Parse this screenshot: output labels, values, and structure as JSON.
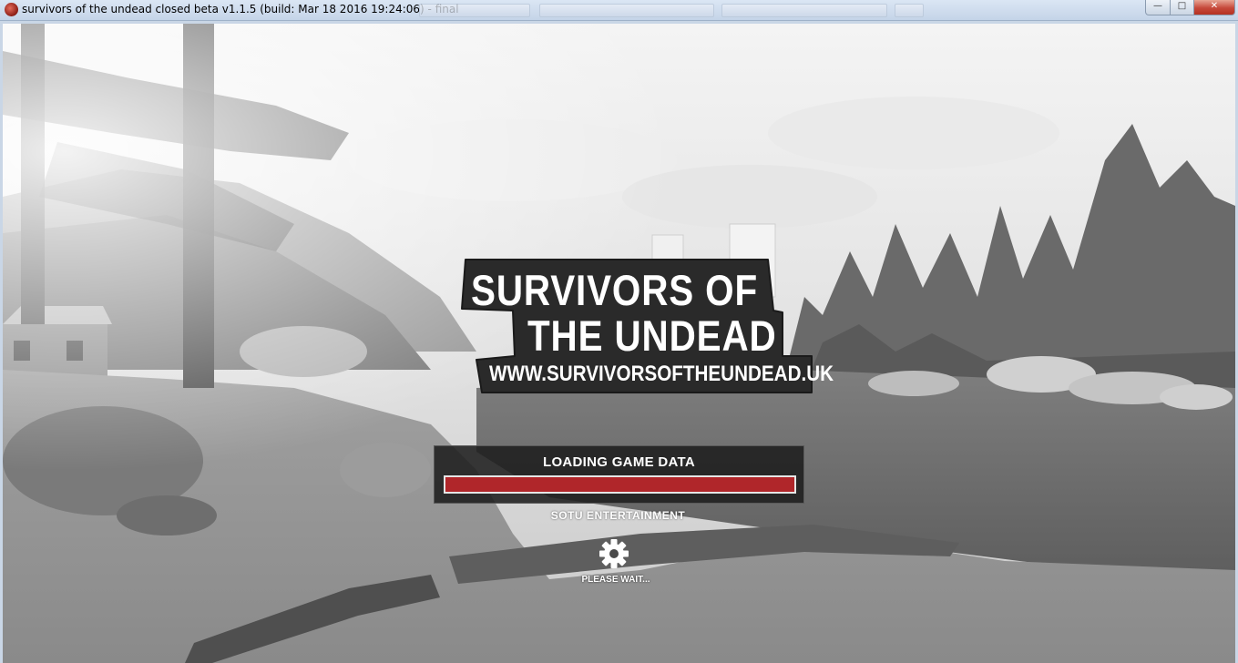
{
  "window": {
    "title": "survivors of the undead closed beta v1.1.5  (build: Mar 18 2016 19:24:06) - final",
    "minimize_glyph": "—",
    "maximize_glyph": "□",
    "close_glyph": "✕"
  },
  "logo": {
    "line1": "SURVIVORS OF",
    "line2": "THE UNDEAD",
    "url": "WWW.SURVIVORSOFTHEUNDEAD.UK"
  },
  "loading": {
    "label": "LOADING GAME DATA",
    "progress_percent": 100,
    "progress_color": "#b0262a"
  },
  "studio": "SOTU ENTERTAINMENT",
  "status": {
    "wait_text": "PLEASE WAIT...",
    "icon": "gear-icon"
  }
}
